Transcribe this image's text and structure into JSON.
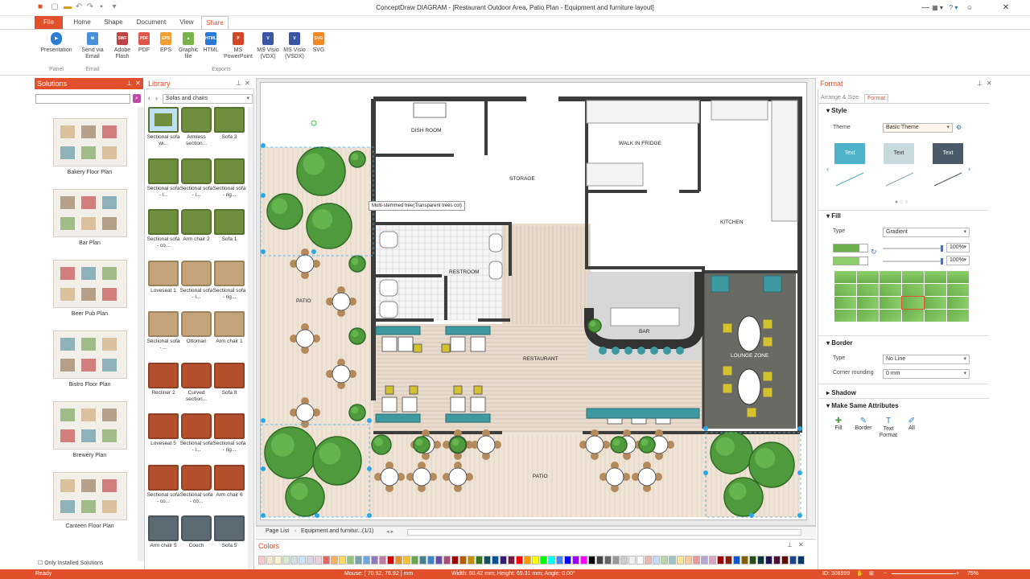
{
  "app": {
    "title": "ConceptDraw DIAGRAM - [Restaurant Outdoor Area, Patio Plan - Equipment and furniture layout]"
  },
  "ribbon": {
    "tabs": [
      "File",
      "Home",
      "Shape",
      "Document",
      "View",
      "Share"
    ],
    "active_tab": "Share",
    "buttons": [
      {
        "label": "Presentation",
        "icon": "presentation-icon"
      },
      {
        "label": "Send via Email",
        "icon": "email-icon"
      },
      {
        "label": "Adobe Flash",
        "icon": "swf-icon"
      },
      {
        "label": "PDF",
        "icon": "pdf-icon"
      },
      {
        "label": "EPS",
        "icon": "eps-icon"
      },
      {
        "label": "Graphic file",
        "icon": "graphic-file-icon"
      },
      {
        "label": "HTML",
        "icon": "html-icon"
      },
      {
        "label": "MS PowerPoint",
        "icon": "powerpoint-icon"
      },
      {
        "label": "MS Visio (VDX)",
        "icon": "visio-vdx-icon"
      },
      {
        "label": "MS Visio (VSDX)",
        "icon": "visio-vsdx-icon"
      },
      {
        "label": "SVG",
        "icon": "svg-icon"
      }
    ],
    "groups": [
      "Panel",
      "Email",
      "Exports"
    ],
    "icon_texts": {
      "swf": "SWF",
      "pdf": "PDF",
      "eps": "EPS",
      "html": "HTML",
      "vdx": "V",
      "vsdx": "V",
      "svg": "SVG"
    }
  },
  "solutions": {
    "title": "Solutions",
    "items": [
      "Bakery Floor Plan",
      "Bar Plan",
      "Beer Pub Plan",
      "Bistro Floor Plan",
      "Brewery Plan",
      "Canteen Floor Plan"
    ],
    "footer_checkbox": "Only Installed Solutions"
  },
  "library": {
    "title": "Library",
    "selected": "Sofas and chairs",
    "items": [
      "Sectional sofa wi...",
      "Armless section...",
      "Sofa 3",
      "Sectional sofa - l...",
      "Sectional sofa - l...",
      "Sectional sofa - rig...",
      "Sectional sofa - co...",
      "Arm chair 2",
      "Sofa 1",
      "Loveseat 1",
      "Sectional sofa - l...",
      "Sectional sofa - rig...",
      "Sectional sofa - ...",
      "Ottoman",
      "Arm chair 1",
      "Recliner 2",
      "Curved section...",
      "Sofa 8",
      "Loveseat 5",
      "Sectional sofa - l...",
      "Sectional sofa - rig...",
      "Sectional sofa - co...",
      "Sectional sofa - co...",
      "Arm chair 6",
      "Arm chair 5",
      "Couch",
      "Sofa 5"
    ]
  },
  "canvas": {
    "rooms": [
      "DISH ROOM",
      "STORAGE",
      "WALK IN FRIDGE",
      "KITCHEN",
      "RESTROOM",
      "BAR",
      "RESTAURANT",
      "LOUNGE ZONE",
      "PATIO",
      "PATIO"
    ],
    "tooltip": "Multi-stemmed tree(Transparent trees col)"
  },
  "pagebar": {
    "page_list": "Page List",
    "page_name": "Equipment and furnitur...",
    "page_count": "(1/1)"
  },
  "colors_panel": {
    "title": "Colors",
    "swatches": [
      "#f4cccc",
      "#fce5cd",
      "#fff2cc",
      "#d9ead3",
      "#d0e0e3",
      "#cfe2f3",
      "#d9d2e9",
      "#ead1dc",
      "#e06666",
      "#f6b26b",
      "#ffd966",
      "#93c47d",
      "#76a5af",
      "#6fa8dc",
      "#8e7cc3",
      "#c27ba0",
      "#cc0000",
      "#e69138",
      "#f1c232",
      "#6aa84f",
      "#45818e",
      "#3d85c6",
      "#674ea7",
      "#a64d79",
      "#990000",
      "#b45f06",
      "#bf9000",
      "#38761d",
      "#134f5c",
      "#0b5394",
      "#351c75",
      "#741b47",
      "#ff0000",
      "#ff9900",
      "#ffff00",
      "#00ff00",
      "#00ffff",
      "#4a86e8",
      "#0000ff",
      "#9900ff",
      "#ff00ff",
      "#000000",
      "#434343",
      "#666666",
      "#999999",
      "#cccccc",
      "#efefef",
      "#ffffff",
      "#e6b8af",
      "#c9daf8",
      "#b6d7a8",
      "#a2c4c9",
      "#ffe599",
      "#f9cb9c",
      "#ea9999",
      "#b4a7d6",
      "#d5a6bd",
      "#980000",
      "#85200c",
      "#1155cc",
      "#7f6000",
      "#274e13",
      "#0c343d",
      "#20124d",
      "#4c1130",
      "#5b0f00",
      "#1c4587",
      "#073763"
    ]
  },
  "format": {
    "title": "Format",
    "subtabs": [
      "Arrange & Size",
      "Format"
    ],
    "active_subtab": "Format",
    "style": {
      "heading": "Style",
      "theme_label": "Theme",
      "theme_value": "Basic Theme",
      "samples": [
        "Text",
        "Text",
        "Text"
      ]
    },
    "fill": {
      "heading": "Fill",
      "type_label": "Type",
      "type_value": "Gradient",
      "opacity1": "100%",
      "opacity2": "100%",
      "primary_color": "#6ab04c",
      "secondary_color": "#8ccf6a"
    },
    "border": {
      "heading": "Border",
      "type_label": "Type",
      "type_value": "No Line",
      "corner_label": "Corner rounding",
      "corner_value": "0 mm"
    },
    "shadow": {
      "heading": "Shadow"
    },
    "same": {
      "heading": "Make Same Attributes",
      "buttons": [
        "Fill",
        "Border",
        "Text Format",
        "All"
      ]
    }
  },
  "status": {
    "ready": "Ready",
    "mouse": "Mouse: [ 70.92, 76.92 ] mm",
    "size": "Width: 60.42 mm;  Height: 69.31 mm;  Angle: 0.00°",
    "id": "ID: 308999",
    "zoom": "75%"
  },
  "colors": {
    "accent": "#e1502a",
    "wall": "#3c3c3c",
    "tree": "#4f9a3d",
    "sofa": "#3e9aa0"
  }
}
